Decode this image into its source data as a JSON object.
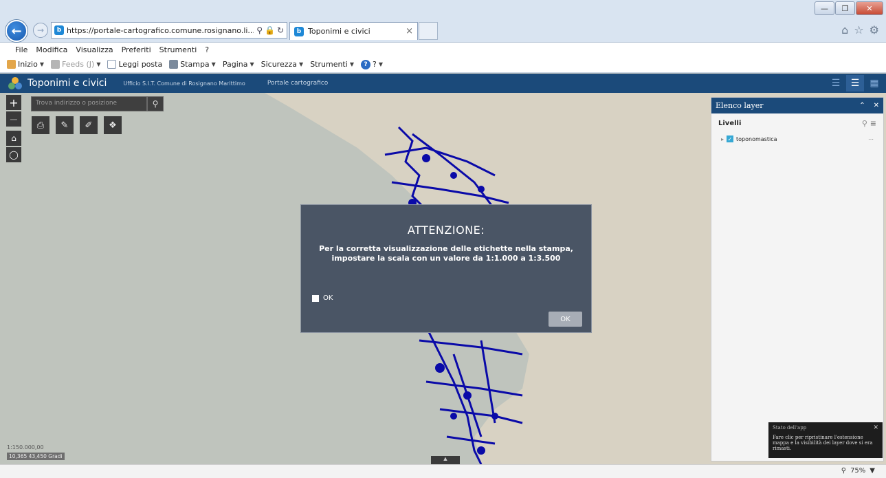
{
  "browser": {
    "url": "https://portale-cartografico.comune.rosignano.li...",
    "tab_title": "Toponimi e civici",
    "menu": [
      "File",
      "Modifica",
      "Visualizza",
      "Preferiti",
      "Strumenti",
      "?"
    ],
    "favbar": {
      "home": "Inizio",
      "feeds": "Feeds (J)",
      "mail": "Leggi posta",
      "print": "Stampa",
      "page": "Pagina",
      "security": "Sicurezza",
      "tools": "Strumenti",
      "help": "?"
    },
    "zoom": "75%"
  },
  "app": {
    "title": "Toponimi e civici",
    "subtitle": "Ufficio S.I.T. Comune di Rosignano Marittimo",
    "portal_link": "Portale cartografico"
  },
  "map": {
    "search_placeholder": "Trova indirizzo o posizione",
    "scale": "1:150.000,00",
    "coordinates": "10,365 43,450 Gradi",
    "colors": {
      "land": "#d8d2c3",
      "sea": "#bfc4bd",
      "roads": "#0a0aa8"
    }
  },
  "layer_panel": {
    "title": "Elenco layer",
    "section": "Livelli",
    "layers": [
      {
        "name": "toponomastica",
        "checked": true
      }
    ]
  },
  "status_popup": {
    "title": "Stato dell'app",
    "text": "Fare clic per ripristinare l'estensione mappa e la visibilità dei layer dove si era rimasti."
  },
  "modal": {
    "title": "ATTENZIONE:",
    "line1": "Per la corretta visualizzazione delle etichette nella stampa,",
    "line2": "impostare la scala con un valore da 1:1.000 a 1:3.500",
    "checkbox_label": "OK",
    "ok_button": "OK"
  }
}
